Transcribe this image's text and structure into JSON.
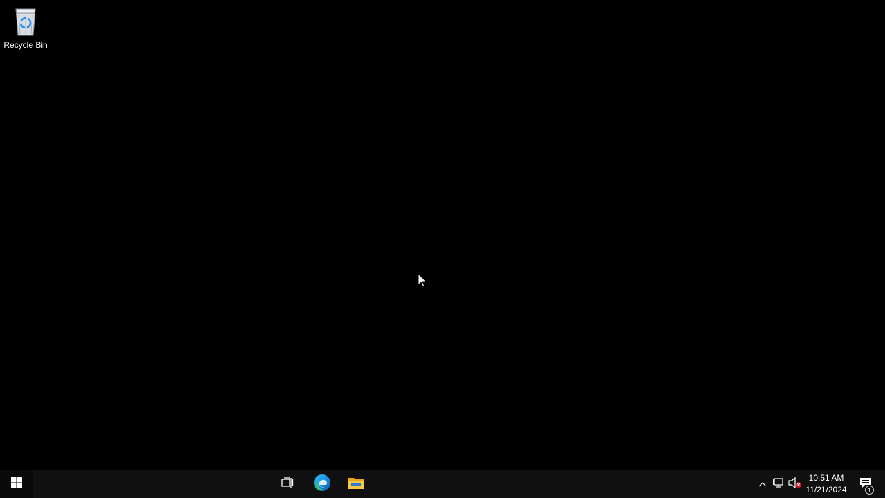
{
  "desktop": {
    "icons": [
      {
        "label": "Recycle Bin",
        "icon": "recycle-bin-icon"
      }
    ],
    "background_color": "#000000"
  },
  "taskbar": {
    "start": {
      "icon": "windows-logo-icon"
    },
    "pinned": [
      {
        "icon": "task-view-icon"
      },
      {
        "icon": "edge-icon"
      },
      {
        "icon": "file-explorer-icon"
      }
    ],
    "tray": {
      "icons": [
        "chevron-up-icon",
        "network-disconnected-icon",
        "volume-muted-icon"
      ],
      "time": "10:51 AM",
      "date": "11/21/2024",
      "notification_count": "1"
    },
    "background_color": "#101010",
    "accent_color": "#0078d7"
  }
}
